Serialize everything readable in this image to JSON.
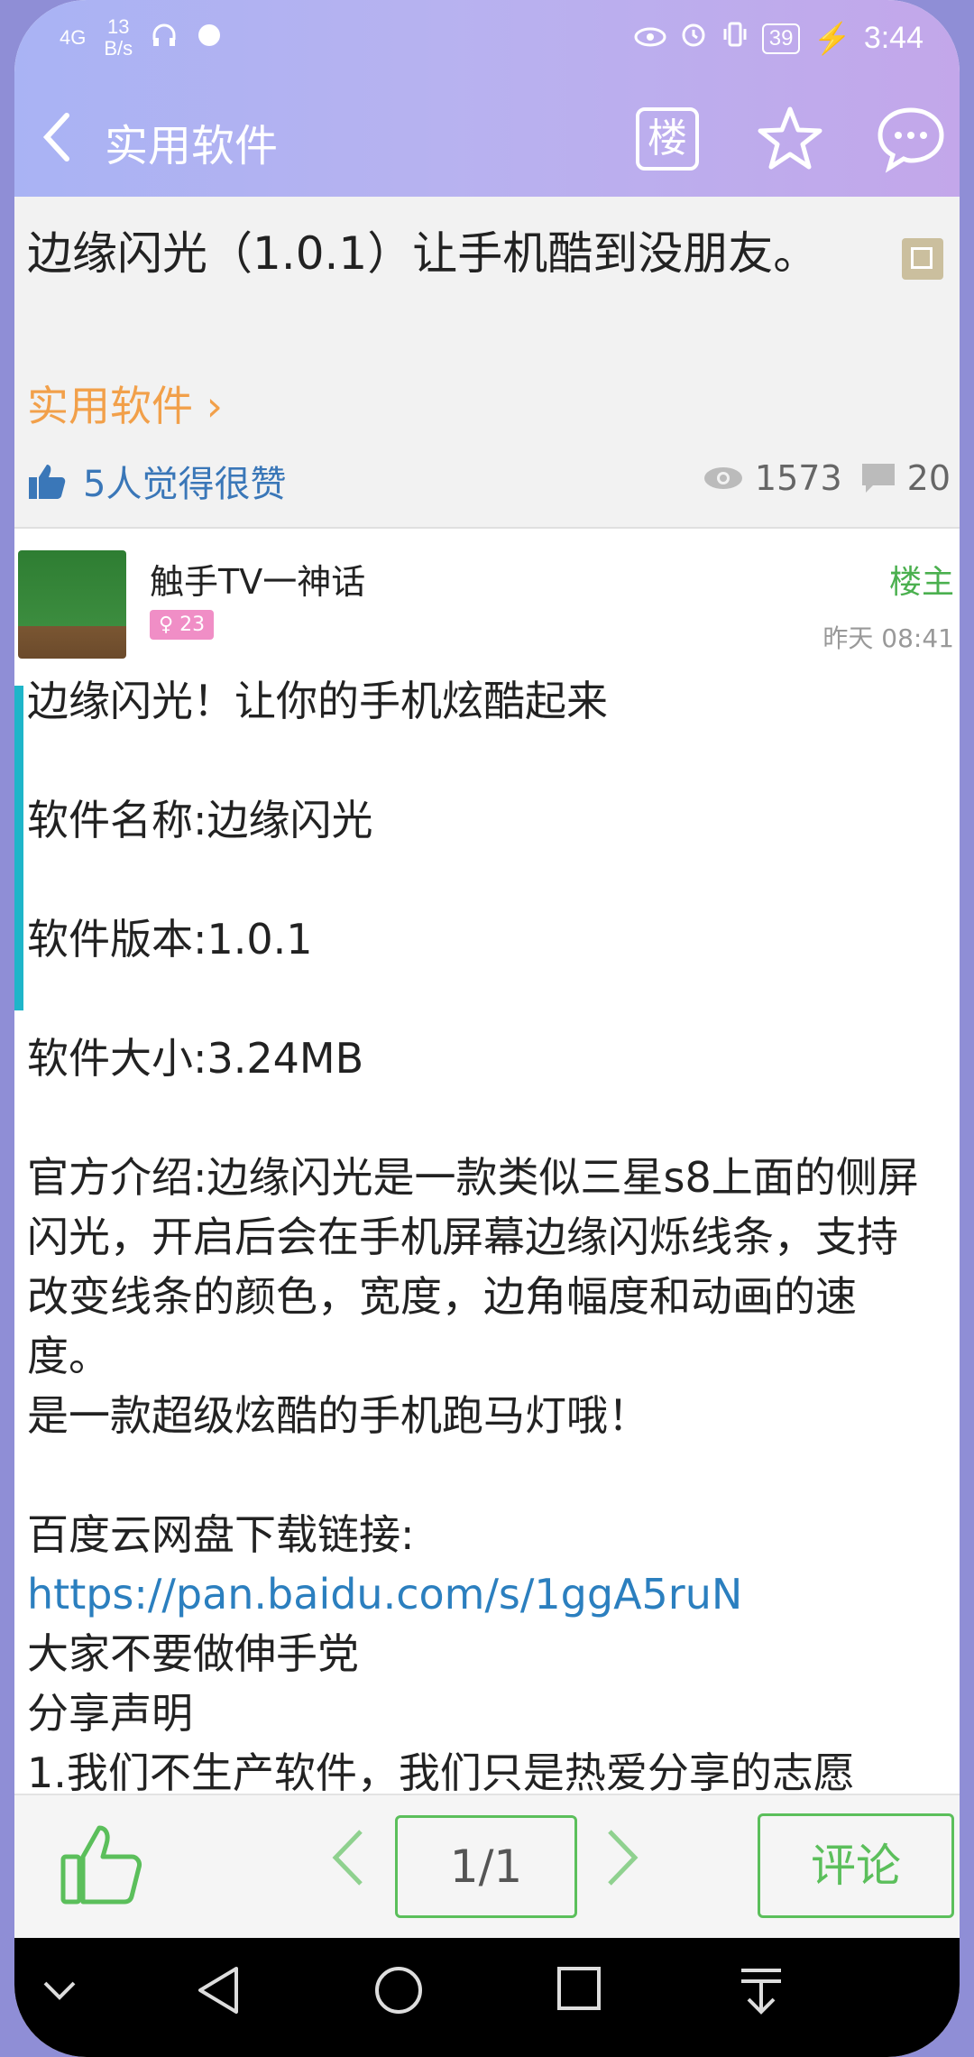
{
  "status_bar": {
    "signal": "4G",
    "speed_value": "13",
    "speed_unit": "B/s",
    "battery": "39",
    "time": "3:44"
  },
  "header": {
    "back_icon": "chevron-left-icon",
    "title": "实用软件",
    "floor_button": "楼",
    "favorite_icon": "star-icon",
    "message_icon": "chat-bubble-icon"
  },
  "post": {
    "title": "边缘闪光（1.0.1）让手机酷到没朋友。",
    "category": "实用软件",
    "likes_text": "5人觉得很赞",
    "views": "1573",
    "comments": "20"
  },
  "author": {
    "name": "触手TV一神话",
    "badge": "♀ 23",
    "role": "楼主",
    "time": "昨天 08:41"
  },
  "content": {
    "line1": "边缘闪光！让你的手机炫酷起来",
    "name_line": "软件名称:边缘闪光",
    "version_line": "软件版本:1.0.1",
    "size_line": "软件大小:3.24MB",
    "intro": "官方介绍:边缘闪光是一款类似三星s8上面的侧屏闪光，开启后会在手机屏幕边缘闪烁线条，支持改变线条的颜色，宽度，边角幅度和动画的速度。",
    "intro2": "是一款超级炫酷的手机跑马灯哦！",
    "download_label": "百度云网盘下载链接:",
    "download_link": "https://pan.baidu.com/s/1ggA5ruN",
    "note1": "大家不要做伸手党",
    "note2": "分享声明",
    "note3": "1.我们不生产软件，我们只是热爱分享的志愿"
  },
  "bottom_bar": {
    "page": "1/1",
    "comment": "评论"
  },
  "colors": {
    "accent_green": "#5bbf5b",
    "link_blue": "#2b7fbf",
    "category_orange": "#f2a04a"
  }
}
